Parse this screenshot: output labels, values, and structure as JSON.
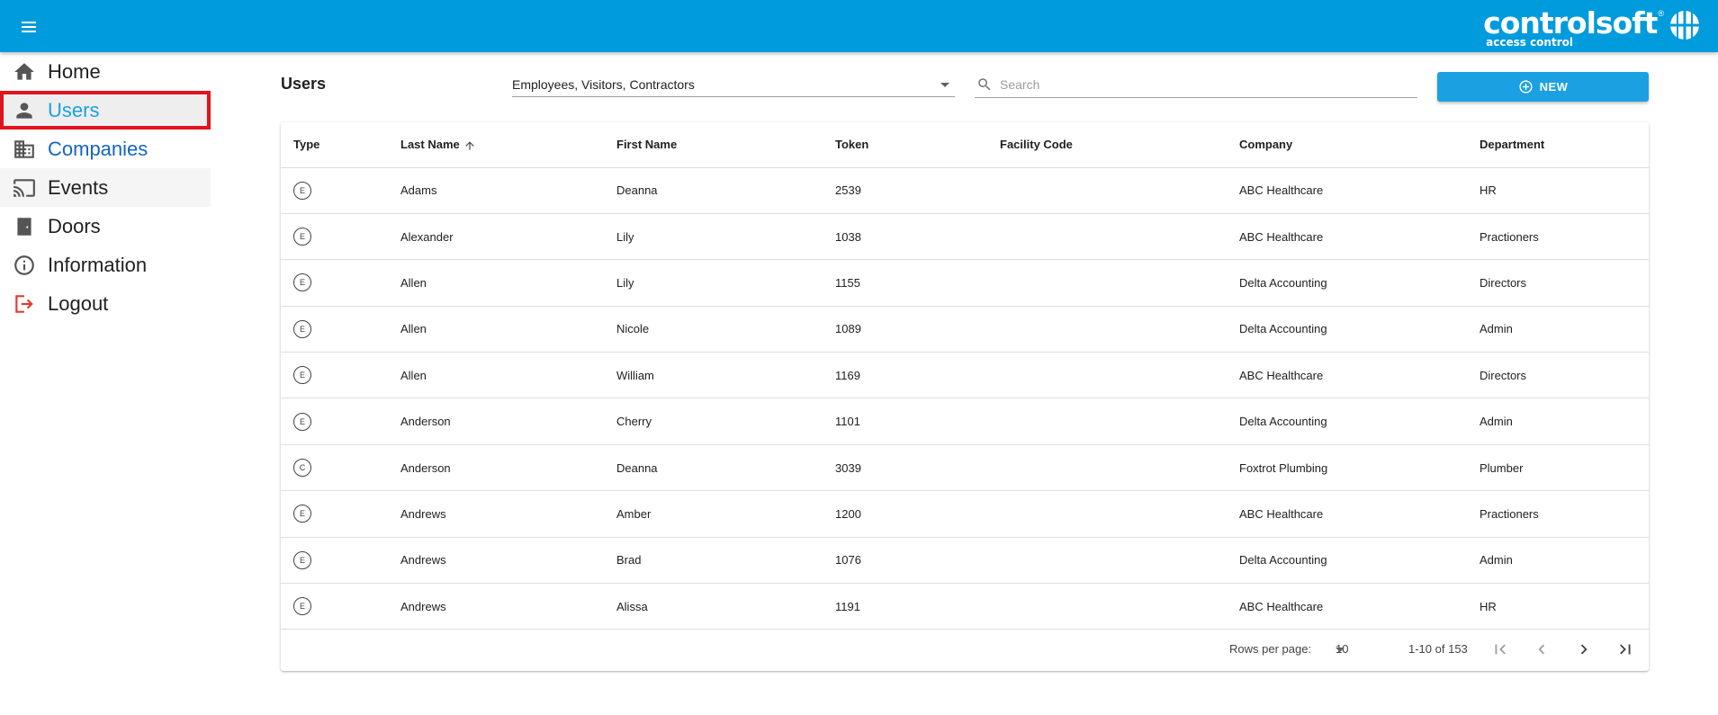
{
  "app": {
    "logo_main": "controlsoft",
    "logo_sub": "access control",
    "logo_reg": "®"
  },
  "sidebar": {
    "items": [
      {
        "label": "Home",
        "icon": "home-icon"
      },
      {
        "label": "Users",
        "icon": "person-icon"
      },
      {
        "label": "Companies",
        "icon": "building-icon"
      },
      {
        "label": "Events",
        "icon": "cast-icon"
      },
      {
        "label": "Doors",
        "icon": "door-icon"
      },
      {
        "label": "Information",
        "icon": "info-icon"
      },
      {
        "label": "Logout",
        "icon": "logout-icon"
      }
    ]
  },
  "main": {
    "title": "Users",
    "filter_value": "Employees, Visitors, Contractors",
    "search_placeholder": "Search",
    "new_label": "NEW"
  },
  "table": {
    "headers": [
      "Type",
      "Last Name",
      "First Name",
      "Token",
      "Facility Code",
      "Company",
      "Department"
    ],
    "rows": [
      {
        "type": "E",
        "last": "Adams",
        "first": "Deanna",
        "token": "2539",
        "facility": "",
        "company": "ABC Healthcare",
        "department": "HR"
      },
      {
        "type": "E",
        "last": "Alexander",
        "first": "Lily",
        "token": "1038",
        "facility": "",
        "company": "ABC Healthcare",
        "department": "Practioners"
      },
      {
        "type": "E",
        "last": "Allen",
        "first": "Lily",
        "token": "1155",
        "facility": "",
        "company": "Delta Accounting",
        "department": "Directors"
      },
      {
        "type": "E",
        "last": "Allen",
        "first": "Nicole",
        "token": "1089",
        "facility": "",
        "company": "Delta Accounting",
        "department": "Admin"
      },
      {
        "type": "E",
        "last": "Allen",
        "first": "William",
        "token": "1169",
        "facility": "",
        "company": "ABC Healthcare",
        "department": "Directors"
      },
      {
        "type": "E",
        "last": "Anderson",
        "first": "Cherry",
        "token": "1101",
        "facility": "",
        "company": "Delta Accounting",
        "department": "Admin"
      },
      {
        "type": "C",
        "last": "Anderson",
        "first": "Deanna",
        "token": "3039",
        "facility": "",
        "company": "Foxtrot Plumbing",
        "department": "Plumber"
      },
      {
        "type": "E",
        "last": "Andrews",
        "first": "Amber",
        "token": "1200",
        "facility": "",
        "company": "ABC Healthcare",
        "department": "Practioners"
      },
      {
        "type": "E",
        "last": "Andrews",
        "first": "Brad",
        "token": "1076",
        "facility": "",
        "company": "Delta Accounting",
        "department": "Admin"
      },
      {
        "type": "E",
        "last": "Andrews",
        "first": "Alissa",
        "token": "1191",
        "facility": "",
        "company": "ABC Healthcare",
        "department": "HR"
      }
    ]
  },
  "pager": {
    "rows_per_page_label": "Rows per page:",
    "rows_per_page": "10",
    "range": "1-10 of 153"
  }
}
